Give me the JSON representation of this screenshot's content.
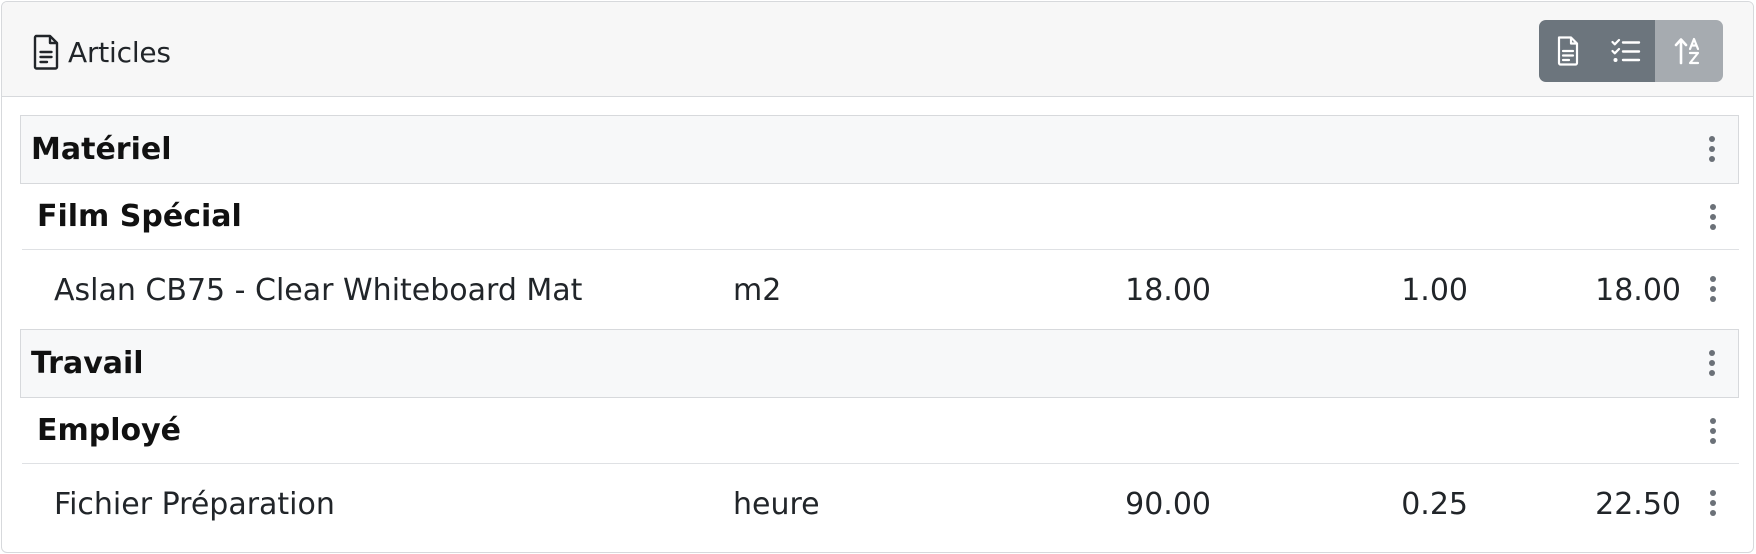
{
  "header": {
    "title": "Articles",
    "title_icon": "file-text-icon",
    "buttons": [
      {
        "icon": "file-text-icon",
        "state": "default"
      },
      {
        "icon": "checklist-icon",
        "state": "default"
      },
      {
        "icon": "sort-alpha-asc-icon",
        "state": "active"
      }
    ]
  },
  "groups": [
    {
      "label": "Matériel",
      "subgroups": [
        {
          "label": "Film Spécial",
          "items": [
            {
              "name": "Aslan CB75 - Clear Whiteboard Mat",
              "unit": "m2",
              "price": "18.00",
              "qty": "1.00",
              "total": "18.00"
            }
          ]
        }
      ]
    },
    {
      "label": "Travail",
      "subgroups": [
        {
          "label": "Employé",
          "items": [
            {
              "name": "Fichier Préparation",
              "unit": "heure",
              "price": "90.00",
              "qty": "0.25",
              "total": "22.50"
            }
          ]
        }
      ]
    }
  ],
  "colors": {
    "header_bg": "#f7f7f7",
    "button_bg": "#6c757d",
    "button_active_bg": "#a6abb0",
    "group_bg": "#f7f8f9",
    "border": "#d7d9dc"
  }
}
